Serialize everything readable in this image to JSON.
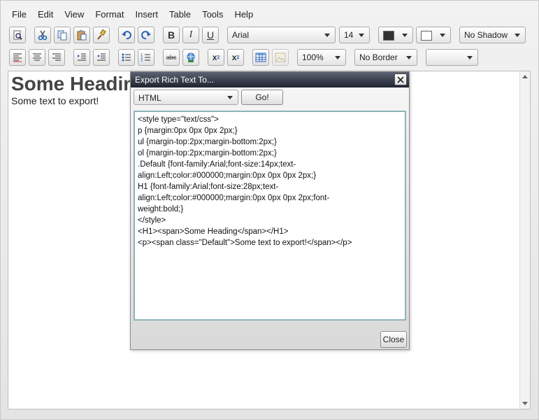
{
  "menu": [
    "File",
    "Edit",
    "View",
    "Format",
    "Insert",
    "Table",
    "Tools",
    "Help"
  ],
  "toolbar1": {
    "bold": "B",
    "italic": "I",
    "underline": "U",
    "font_family": "Arial",
    "font_size": "14",
    "text_color": "#333333",
    "background_color": "#ffffff",
    "shadow": "No Shadow"
  },
  "toolbar2": {
    "spell_label": "abc",
    "superscript_label": "x",
    "subscript_label": "x",
    "zoom": "100%",
    "border": "No Border",
    "extra_dropdown": ""
  },
  "document": {
    "heading": "Some Heading",
    "text": "Some text to export!"
  },
  "dialog": {
    "title": "Export Rich Text To...",
    "format": "HTML",
    "go_label": "Go!",
    "close_label": "Close",
    "output_lines": [
      "<style type=\"text/css\">",
      "p {margin:0px 0px 0px 2px;}",
      "ul {margin-top:2px;margin-bottom:2px;}",
      "ol {margin-top:2px;margin-bottom:2px;}",
      ".Default {font-family:Arial;font-size:14px;text-",
      "align:Left;color:#000000;margin:0px 0px 0px 2px;}",
      "H1 {font-family:Arial;font-size:28px;text-",
      "align:Left;color:#000000;margin:0px 0px 0px 2px;font-",
      "weight:bold;}",
      "</style>",
      "<H1><span>Some Heading</span></H1>",
      "<p><span class=\"Default\">Some text to export!</span></p>"
    ]
  }
}
